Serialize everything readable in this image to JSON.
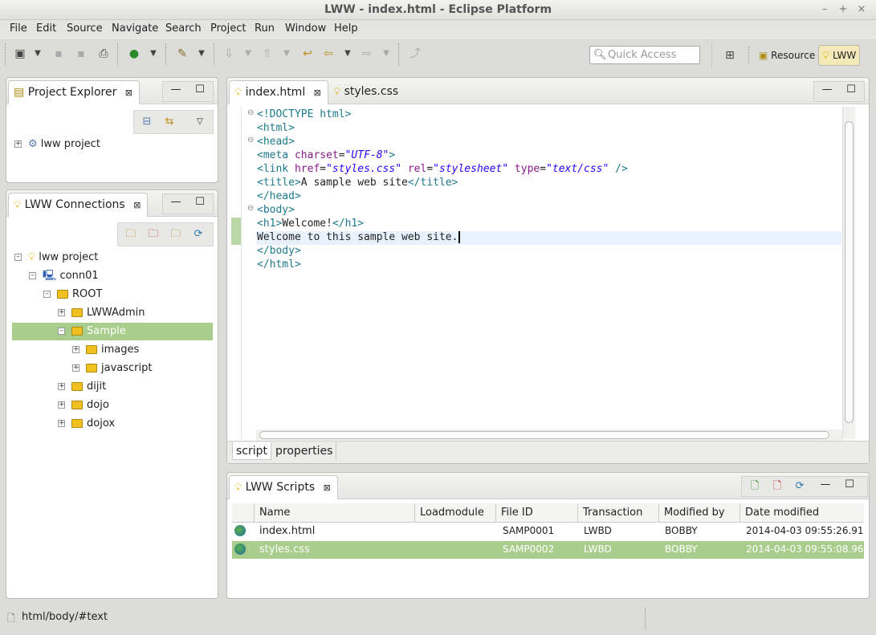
{
  "window": {
    "title": "LWW - index.html - Eclipse Platform",
    "controls": [
      "–",
      "+",
      "×"
    ]
  },
  "menu": [
    "File",
    "Edit",
    "Source",
    "Navigate",
    "Search",
    "Project",
    "Run",
    "Window",
    "Help"
  ],
  "toolbar": {
    "quick_access_placeholder": "Quick Access",
    "perspectives": [
      "Resource",
      "LWW"
    ]
  },
  "project_explorer": {
    "title": "Project Explorer",
    "items": [
      {
        "label": "lww project"
      }
    ]
  },
  "connections": {
    "title": "LWW Connections",
    "tree": [
      {
        "label": "lww project",
        "expander": "–"
      },
      {
        "label": "conn01",
        "expander": "–"
      },
      {
        "label": "ROOT",
        "expander": "–"
      },
      {
        "label": "LWWAdmin",
        "expander": "+"
      },
      {
        "label": "Sample",
        "expander": "–",
        "selected": true
      },
      {
        "label": "images",
        "expander": "+"
      },
      {
        "label": "javascript",
        "expander": "+"
      },
      {
        "label": "dijit",
        "expander": "+"
      },
      {
        "label": "dojo",
        "expander": "+"
      },
      {
        "label": "dojox",
        "expander": "+"
      }
    ]
  },
  "editor": {
    "tabs": [
      "index.html",
      "styles.css"
    ],
    "bottom_tabs": [
      "script",
      "properties"
    ],
    "lines": [
      "<!DOCTYPE html>",
      "<html>",
      "<head>",
      "<meta charset=\"UTF-8\">",
      "<link href=\"styles.css\" rel=\"stylesheet\" type=\"text/css\" />",
      "<title>A sample web site</title>",
      "</head>",
      "<body>",
      "<h1>Welcome!</h1>",
      "Welcome to this sample web site.",
      "</body>",
      "</html>"
    ]
  },
  "scripts": {
    "title": "LWW Scripts",
    "columns": [
      "Name",
      "Loadmodule",
      "File ID",
      "Transaction",
      "Modified by",
      "Date modified"
    ],
    "rows": [
      {
        "name": "index.html",
        "loadmodule": "",
        "file_id": "SAMP0001",
        "transaction": "LWBD",
        "modified_by": "BOBBY",
        "date": "2014-04-03 09:55:26.91"
      },
      {
        "name": "styles.css",
        "loadmodule": "",
        "file_id": "SAMP0002",
        "transaction": "LWBD",
        "modified_by": "BOBBY",
        "date": "2014-04-03 09:55:08.96",
        "selected": true
      }
    ]
  },
  "status": {
    "path": "html/body/#text"
  }
}
